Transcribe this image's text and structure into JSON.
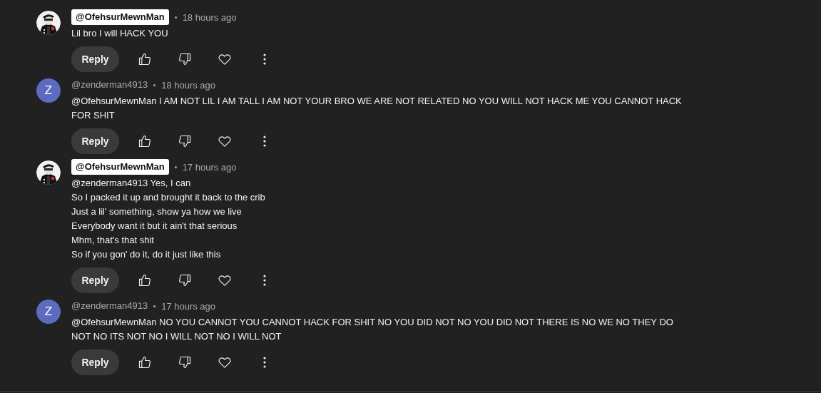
{
  "comments": [
    {
      "author": "@OfehsurMewnMan",
      "highlighted": true,
      "time": "18 hours ago",
      "text": "Lil bro I will HACK YOU",
      "reply": "Reply"
    },
    {
      "author": "@zenderman4913",
      "highlighted": false,
      "avatar": {
        "kind": "letter",
        "letter": "Z",
        "color": "#5c6bc0"
      },
      "time": "18 hours ago",
      "text": "@OfehsurMewnMan I AM NOT LIL I AM TALL I AM NOT YOUR BRO WE ARE NOT RELATED NO YOU WILL NOT HACK ME YOU CANNOT HACK FOR SHIT",
      "reply": "Reply"
    },
    {
      "author": "@OfehsurMewnMan",
      "highlighted": true,
      "time": "17 hours ago",
      "text": "@zenderman4913 Yes, I can\nSo I packed it up and brought it back to the crib\nJust a lil' something, show ya how we live\nEverybody want it but it ain't that serious\nMhm, that's that shit\nSo if you gon' do it, do it just like this",
      "reply": "Reply"
    },
    {
      "author": "@zenderman4913",
      "highlighted": false,
      "avatar": {
        "kind": "letter",
        "letter": "Z",
        "color": "#5c6bc0"
      },
      "time": "17 hours ago",
      "text": "@OfehsurMewnMan NO YOU CANNOT YOU CANNOT HACK FOR SHIT NO YOU DID NOT NO YOU DID NOT THERE IS NO WE NO THEY DO NOT NO ITS NOT NO I WILL NOT NO I WILL NOT",
      "reply": "Reply"
    }
  ]
}
